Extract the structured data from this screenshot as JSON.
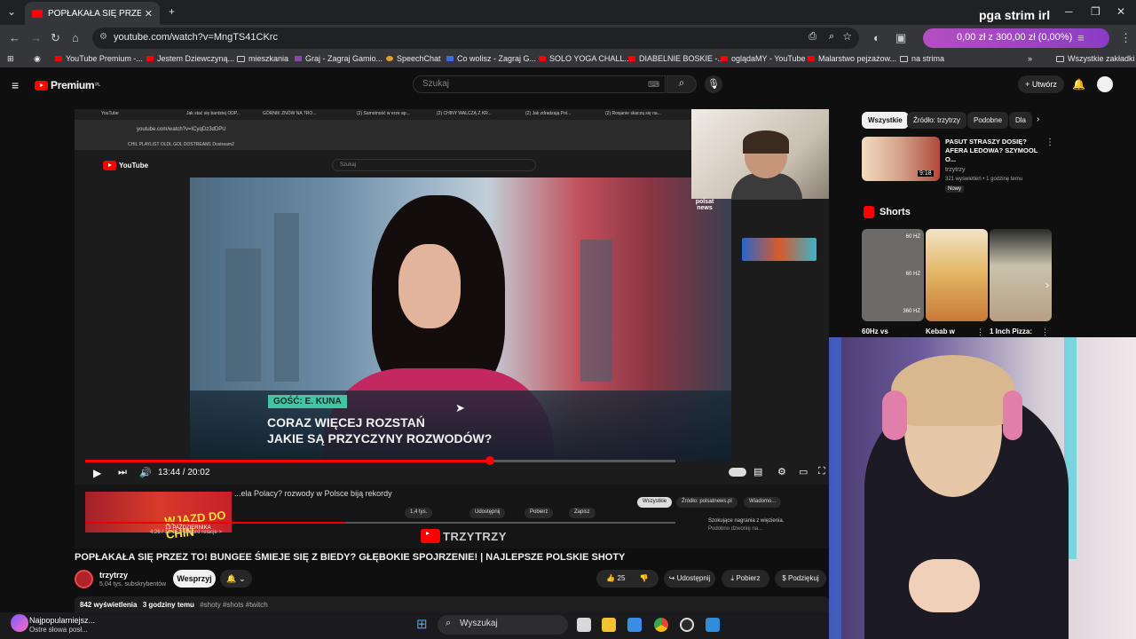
{
  "browser": {
    "active_tab_title": "POPŁAKAŁA SIĘ PRZEZ TO! BUN",
    "url": "youtube.com/watch?v=MngTS41CKrc",
    "bookmarks": [
      "YouTube Premium -...",
      "Jestem Dziewczyną...",
      "mieszkania",
      "Graj - Zagraj Gamio...",
      "SpeechChat",
      "Co wolisz - Zagraj G...",
      "SOLO YOGA CHALL...",
      "DIABELNIE BOSKIE -...",
      "oglądaMY - YouTube",
      "Malarstwo pejzażow...",
      "na strima"
    ],
    "bookmarks_all": "Wszystkie zakładki"
  },
  "stream": {
    "title": "pga strim irl",
    "donation": "0,00 zł z 300,00 zł (0,00%)"
  },
  "youtube": {
    "logo_text": "Premium",
    "logo_suffix": "PL",
    "search_placeholder": "Szukaj",
    "create_label": "Utwórz"
  },
  "player": {
    "inner_tabs": [
      "YouTube",
      "Jak stać się bardziej ODP...",
      "GÓRNIK ZNÓW NA TRO...",
      "(2) Samotność w erze ap...",
      "(2) CHINY WALCZĄ Z KR...",
      "(2) Jak zdradzają Pol...",
      "(2) Rosjanie skaczą się na..."
    ],
    "inner_url": "youtube.com/watch?v=ICyqDz3dDPU",
    "inner_bookmarks": "CHIL PLAYLIST    OLDL    GOL    DOSTREAM1    Dostream2",
    "inner_search_placeholder": "Szukaj",
    "guest_tag": "GOŚĆ: E. KUNA",
    "headline_line1": "CORAZ WIĘCEJ ROZSTAŃ",
    "headline_line2": "JAKIE SĄ PRZYCZYNY ROZWODÓW?",
    "polsat": "polsat news",
    "time": "13:44 / 20:02",
    "progress": 0.685,
    "inner_video_title": "...ela Polacy? rozwody w Polsce biją rekordy",
    "inner_time": "4:26 / 13:15 • Dekord relacje >",
    "inner_likes": "1,4 tys.",
    "inner_share": "Udostępnij",
    "inner_download": "Pobierz",
    "inner_save": "Zapisz",
    "inner_chip_all": "Wszystkie",
    "inner_chip_source": "Źródło: polsatnews.pl",
    "inner_chip_news": "Wiadomo...",
    "inner_related": "Szokujące nagrania z więzienia.",
    "inner_related_2": "Podobno dzwonię na...",
    "inner_thumb_text": "WJAZD DO CHIN",
    "inner_thumb_date": "13 PAŹDZIERNIKA",
    "watermark": "TRZYTRZY"
  },
  "video": {
    "title": "POPŁAKAŁA SIĘ PRZEZ TO! BUNGEE ŚMIEJE SIĘ Z BIEDY? GŁĘBOKIE SPOJRZENIE! | NAJLEPSZE POLSKIE SHOTY",
    "channel": "trzytrzy",
    "subs": "5,04 tys. subskrybentów",
    "support": "Wesprzyj",
    "likes": "25",
    "share": "Udostępnij",
    "download": "Pobierz",
    "thanks": "Podziękuj",
    "views": "842 wyświetlenia",
    "age": "3 godziny temu",
    "tags": "#shoty #shots #twitch"
  },
  "sidebar": {
    "chips": [
      "Wszystkie",
      "Źródło: trzytrzy",
      "Podobne",
      "Dla"
    ],
    "rec_title": "PASUT STRASZY DOSIĘ? AFERA LEDOWA? SZYMOOL O...",
    "rec_channel": "trzytrzy",
    "rec_meta": "321 wyświetleń • 1 godzinę temu",
    "rec_badge": "Nowy",
    "rec_duration": "9:18",
    "shorts_title": "Shorts",
    "shorts": [
      {
        "label": "60Hz vs",
        "tags": [
          "60 HZ",
          "60 HZ",
          "360 HZ"
        ]
      },
      {
        "label": "Kebab w"
      },
      {
        "label": "1 Inch Pizza:"
      }
    ]
  },
  "taskbar": {
    "search": "Wyszukaj",
    "notif_title": "Najpopularniejsz...",
    "notif_body": "Ostre słowa posł..."
  },
  "colors": {
    "accent": "#ff0000",
    "donation_bg": "#a045c4",
    "guest_tag": "#41c6a4"
  }
}
